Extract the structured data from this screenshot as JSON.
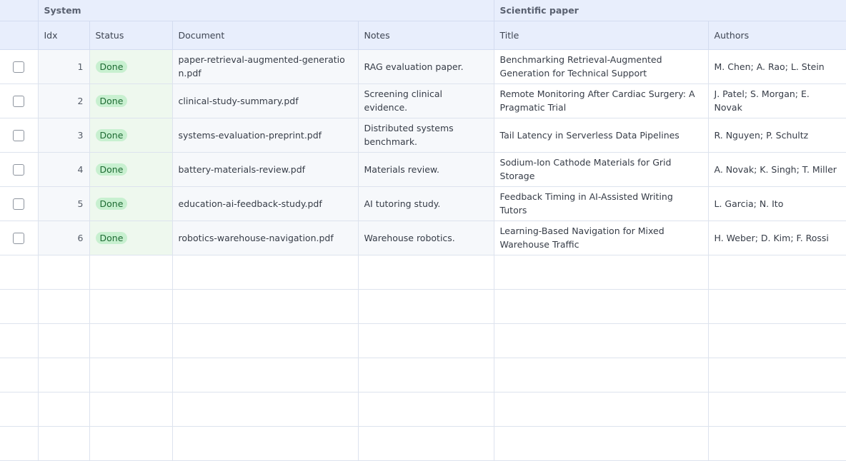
{
  "groups": {
    "system": "System",
    "paper": "Scientific paper"
  },
  "columns": {
    "idx": "Idx",
    "status": "Status",
    "document": "Document",
    "notes": "Notes",
    "title": "Title",
    "authors": "Authors"
  },
  "rows": [
    {
      "idx": "1",
      "status": "Done",
      "document": "paper-retrieval-augmented-generation.pdf",
      "notes": "RAG evaluation paper.",
      "title": "Benchmarking Retrieval-Augmented Generation for Technical Support",
      "authors": "M. Chen; A. Rao; L. Stein"
    },
    {
      "idx": "2",
      "status": "Done",
      "document": "clinical-study-summary.pdf",
      "notes": "Screening clinical evidence.",
      "title": "Remote Monitoring After Cardiac Surgery: A Pragmatic Trial",
      "authors": "J. Patel; S. Morgan; E. Novak"
    },
    {
      "idx": "3",
      "status": "Done",
      "document": "systems-evaluation-preprint.pdf",
      "notes": "Distributed systems benchmark.",
      "title": "Tail Latency in Serverless Data Pipelines",
      "authors": "R. Nguyen; P. Schultz"
    },
    {
      "idx": "4",
      "status": "Done",
      "document": "battery-materials-review.pdf",
      "notes": "Materials review.",
      "title": "Sodium-Ion Cathode Materials for Grid Storage",
      "authors": "A. Novak; K. Singh; T. Miller"
    },
    {
      "idx": "5",
      "status": "Done",
      "document": "education-ai-feedback-study.pdf",
      "notes": "AI tutoring study.",
      "title": "Feedback Timing in AI-Assisted Writing Tutors",
      "authors": "L. Garcia; N. Ito"
    },
    {
      "idx": "6",
      "status": "Done",
      "document": "robotics-warehouse-navigation.pdf",
      "notes": "Warehouse robotics.",
      "title": "Learning-Based Navigation for Mixed Warehouse Traffic",
      "authors": "H. Weber; D. Kim; F. Rossi"
    }
  ],
  "colors": {
    "header_bg": "#e8eefc",
    "badge_bg": "#c8f0d0",
    "badge_text": "#1e6b33",
    "status_col_bg": "#eef8ee"
  },
  "icons": {
    "row_select": "checkbox-icon"
  }
}
